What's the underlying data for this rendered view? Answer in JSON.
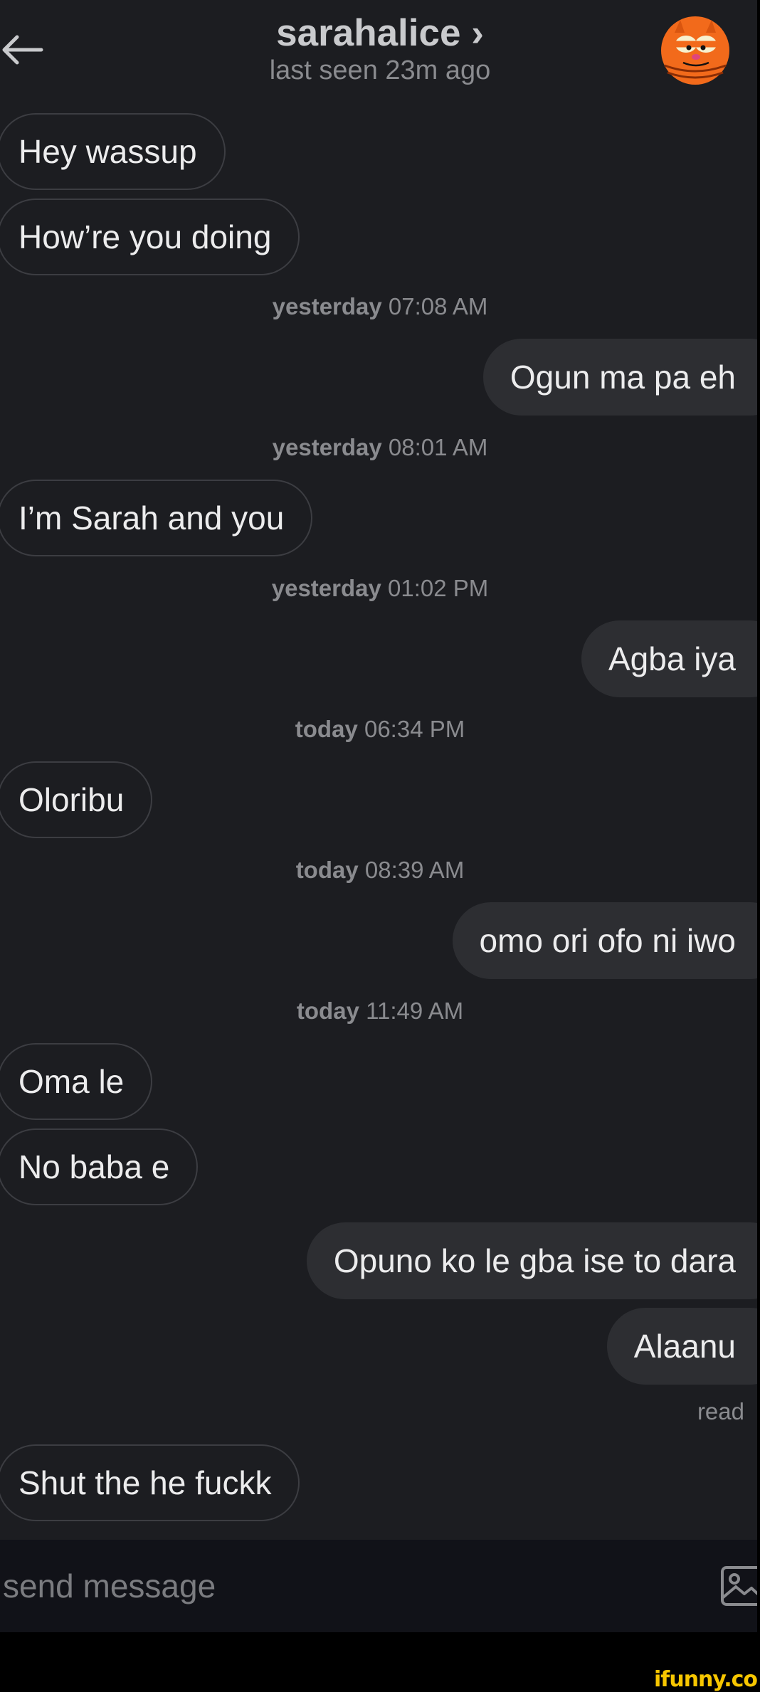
{
  "header": {
    "title": "sarahalice ›",
    "status": "last seen 23m ago",
    "avatar_icon": "garfield-avatar"
  },
  "messages": [
    {
      "from": "them",
      "text": "Hey wassup"
    },
    {
      "from": "them",
      "text": "How’re you doing"
    },
    {
      "type": "timestamp",
      "day": "yesterday",
      "time": "07:08 AM"
    },
    {
      "from": "me",
      "text": "Ogun ma pa eh"
    },
    {
      "type": "timestamp",
      "day": "yesterday",
      "time": "08:01 AM"
    },
    {
      "from": "them",
      "text": "I’m Sarah and you"
    },
    {
      "type": "timestamp",
      "day": "yesterday",
      "time": "01:02 PM"
    },
    {
      "from": "me",
      "text": "Agba iya"
    },
    {
      "type": "timestamp",
      "day": "today",
      "time": "06:34 PM"
    },
    {
      "from": "them",
      "text": "Oloribu"
    },
    {
      "type": "timestamp",
      "day": "today",
      "time": "08:39 AM"
    },
    {
      "from": "me",
      "text": "omo ori ofo ni iwo"
    },
    {
      "type": "timestamp",
      "day": "today",
      "time": "11:49 AM"
    },
    {
      "from": "them",
      "text": "Oma le"
    },
    {
      "from": "them",
      "text": "No baba e"
    },
    {
      "from": "me",
      "text": "Opuno ko le gba ise to dara"
    },
    {
      "from": "me",
      "text": "Alaanu"
    },
    {
      "type": "receipt",
      "text": "read"
    },
    {
      "from": "them",
      "text": "Shut the he fuckk"
    }
  ],
  "composer": {
    "placeholder": "send message",
    "attach_icon": "image-icon"
  },
  "watermark": "ifunny.co",
  "colors": {
    "background": "#1c1d21",
    "incoming_border": "#3c3d42",
    "outgoing_bubble": "#2d2e32",
    "muted_text": "#8a8b8f",
    "composer_bg": "#111218",
    "watermark": "#f7c600",
    "avatar_orange": "#f26a1b"
  }
}
